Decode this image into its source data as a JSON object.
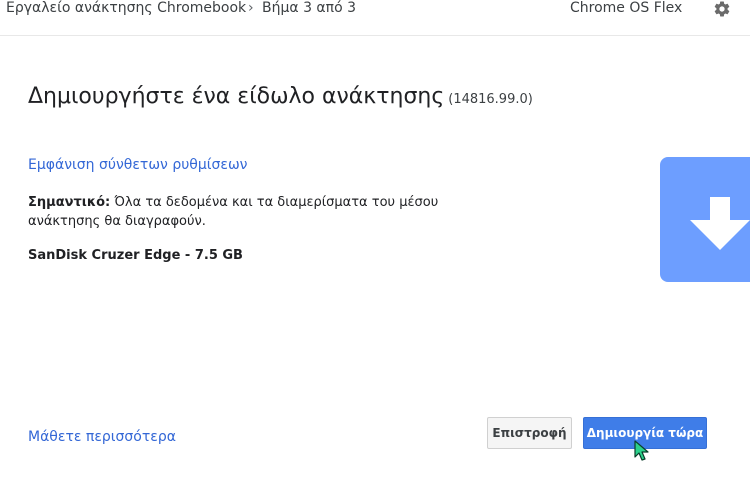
{
  "header": {
    "app_title": "Εργαλείο ανάκτησης Chromebook",
    "breadcrumb_separator": "›",
    "step": "Βήμα 3 από 3",
    "product": "Chrome OS Flex",
    "settings_icon": "gear-icon"
  },
  "main": {
    "title": "Δημιουργήστε ένα είδωλο ανάκτησης",
    "version": "(14816.99.0)",
    "advanced_settings_link": "Εμφάνιση σύνθετων ρυθμίσεων",
    "warning_label": "Σημαντικό:",
    "warning_text": "Όλα τα δεδομένα και τα διαμερίσματα του μέσου ανάκτησης θα διαγραφούν.",
    "device": "SanDisk Cruzer Edge - 7.5 GB",
    "illustration_icon": "download-arrow-icon"
  },
  "footer": {
    "learn_more": "Μάθετε περισσότερα",
    "back_button": "Επιστροφή",
    "create_button": "Δημιουργία τώρα"
  },
  "colors": {
    "accent": "#3f7de8",
    "link": "#3367d6",
    "illustration": "#6d9eff"
  }
}
